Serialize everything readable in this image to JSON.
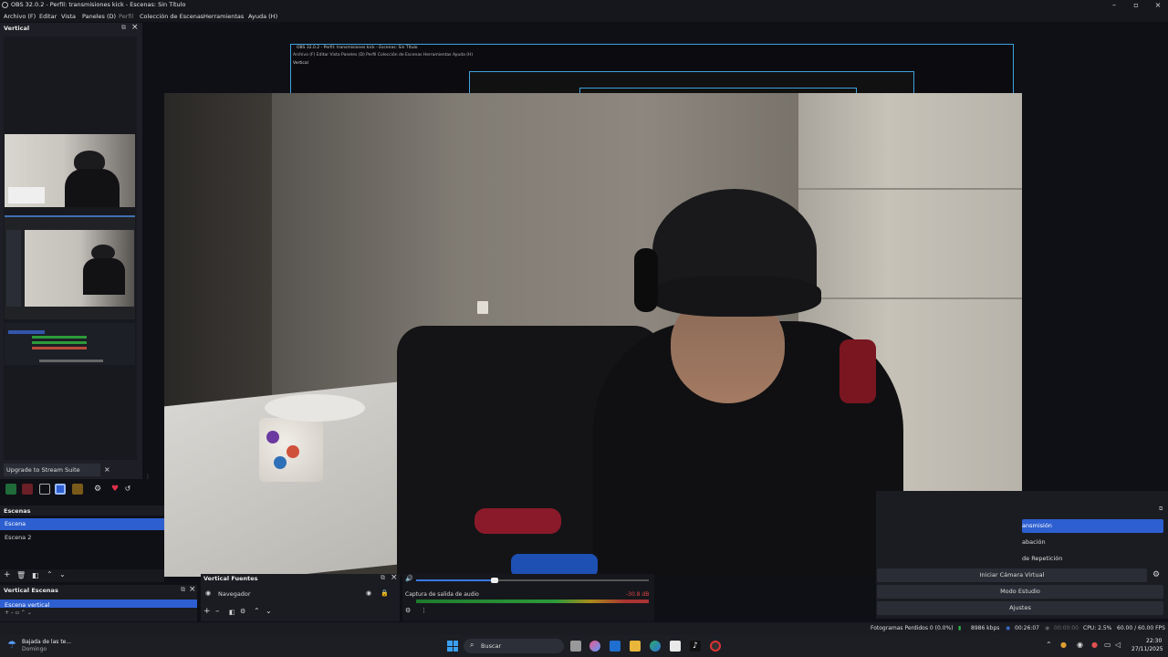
{
  "window": {
    "title": "OBS 32.0.2 - Perfil: transmisiones kick - Escenas: Sin Título"
  },
  "menu": [
    "Archivo (F)",
    "Editar",
    "Vista",
    "Paneles (D)",
    "Perfil",
    "Colección de Escenas",
    "Herramientas",
    "Ayuda (H)"
  ],
  "dock_vertical": {
    "title": "Vertical"
  },
  "upgrade": {
    "label": "Upgrade to Stream Suite",
    "close": "×"
  },
  "nested_preview": {
    "title": "OBS 32.0.2 - Perfil: transmisiones kick - Escenas: Sin Título",
    "menu": "Archivo (F)   Editar   Vista   Paneles (D)   Perfil   Colección de Escenas   Herramientas   Ayuda (H)",
    "dock": "Vertical"
  },
  "scenes": {
    "title": "Escenas",
    "items": [
      "Escena",
      "Escena 2"
    ]
  },
  "vertical_scenes": {
    "title": "Vertical Escenas",
    "items": [
      "Escena vertical"
    ]
  },
  "vertical_sources": {
    "title": "Vertical Fuentes",
    "items": [
      "Navegador"
    ]
  },
  "audio": {
    "source": "Captura de salida de audio",
    "level": "-30.8 dB"
  },
  "controls": [
    "ansmisión",
    "abación",
    "de Repetición",
    "Iniciar Cámara Virtual",
    "Modo Estudio",
    "Ajustes"
  ],
  "status": {
    "dropped": "Fotogramas Perdidos 0 (0.0%)",
    "bitrate": "8986 kbps",
    "live_time": "00:26:07",
    "rec_time": "00:00:00",
    "cpu": "CPU: 2.5%",
    "fps": "60.00 / 60.00 FPS"
  },
  "taskbar": {
    "news_title": "Bajada de las te...",
    "news_sub": "Domingo",
    "search": "Buscar",
    "time": "22:30",
    "date": "27/11/2025"
  },
  "colors": {
    "accent": "#2d5fd1",
    "frame_border": "#3ea2dd",
    "panel": "#1b1c22",
    "background": "#0f1015"
  }
}
